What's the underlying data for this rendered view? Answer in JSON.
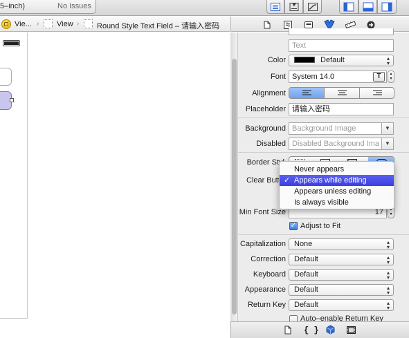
{
  "toolbar": {
    "scheme": "5–inch)",
    "issues": "No Issues"
  },
  "jumpbar": {
    "crumbs": [
      "Vie...",
      "View",
      "Round Style Text Field – 请输入密码"
    ]
  },
  "inspector": {
    "text_value": "Text",
    "color": {
      "label": "Color",
      "value": "Default",
      "swatch": "#000000"
    },
    "font": {
      "label": "Font",
      "value": "System 14.0",
      "button": "T"
    },
    "alignment": {
      "label": "Alignment",
      "selected": "left"
    },
    "placeholder": {
      "label": "Placeholder",
      "value": "请输入密码"
    },
    "background": {
      "label": "Background",
      "placeholder": "Background Image"
    },
    "disabled": {
      "label": "Disabled",
      "placeholder": "Disabled Background Ima"
    },
    "border_style": {
      "label": "Border Styl"
    },
    "clear_button": {
      "label": "Clear Butto",
      "partial_text": "s"
    },
    "min_font_size": {
      "label": "Min Font Size",
      "value": "17"
    },
    "adjust_to_fit": {
      "label": "Adjust to Fit",
      "checked": true
    },
    "capitalization": {
      "label": "Capitalization",
      "value": "None"
    },
    "correction": {
      "label": "Correction",
      "value": "Default"
    },
    "keyboard": {
      "label": "Keyboard",
      "value": "Default"
    },
    "appearance": {
      "label": "Appearance",
      "value": "Default"
    },
    "return_key": {
      "label": "Return Key",
      "value": "Default"
    },
    "auto_enable": {
      "label": "Auto–enable Return Key",
      "checked": false
    }
  },
  "menu": {
    "items": [
      {
        "label": "Never appears",
        "selected": false
      },
      {
        "label": "Appears while editing",
        "selected": true
      },
      {
        "label": "Appears unless editing",
        "selected": false
      },
      {
        "label": "Is always visible",
        "selected": false
      }
    ],
    "checkmark": "✓"
  },
  "bottombar": {
    "curly_icon": "{ }"
  },
  "colors": {
    "accent": "#3b3ee0",
    "selection_blue": "#2f6fd9",
    "canvas_control": "#c9c6ee"
  }
}
